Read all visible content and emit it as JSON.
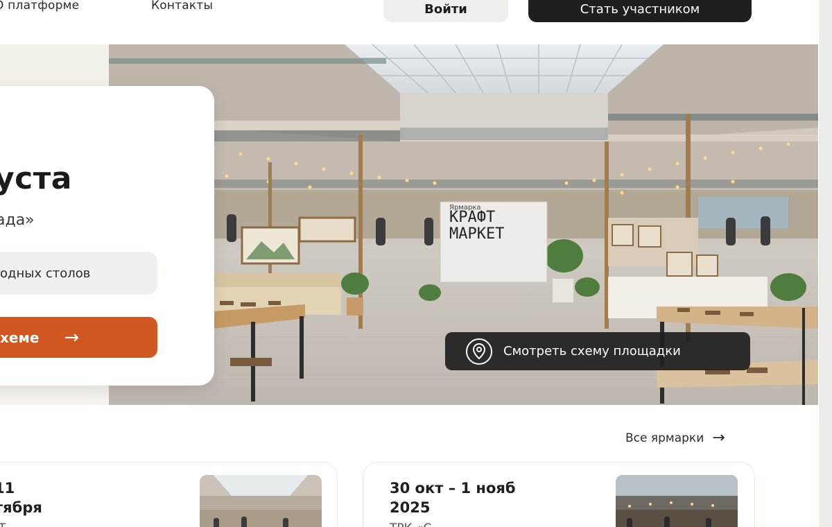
{
  "header": {
    "nav_platform": "О платформе",
    "nav_contacts": "Контакты",
    "login": "Войти",
    "join": "Стать участником"
  },
  "hero": {
    "title": "уста",
    "subtitle": "ада»",
    "pill": "одных столов",
    "cta": "хеме",
    "cta_arrow": "→",
    "sign_small": "Ярмарка",
    "sign_line1": "КРАФТ",
    "sign_line2": "МАРКЕТ",
    "map_button": "Смотреть схему площадки"
  },
  "fairs": {
    "all_link": "Все ярмарки",
    "all_arrow": "→",
    "cards": [
      {
        "date_line1": "11",
        "date_line2": "тября",
        "location": "Т"
      },
      {
        "date_line1": "30 окт – 1 нояб",
        "date_line2": "2025",
        "location": "ТРК «С"
      }
    ]
  },
  "colors": {
    "accent": "#d2561f",
    "dark": "#1f1f1f",
    "light_button": "#f0eeea"
  }
}
